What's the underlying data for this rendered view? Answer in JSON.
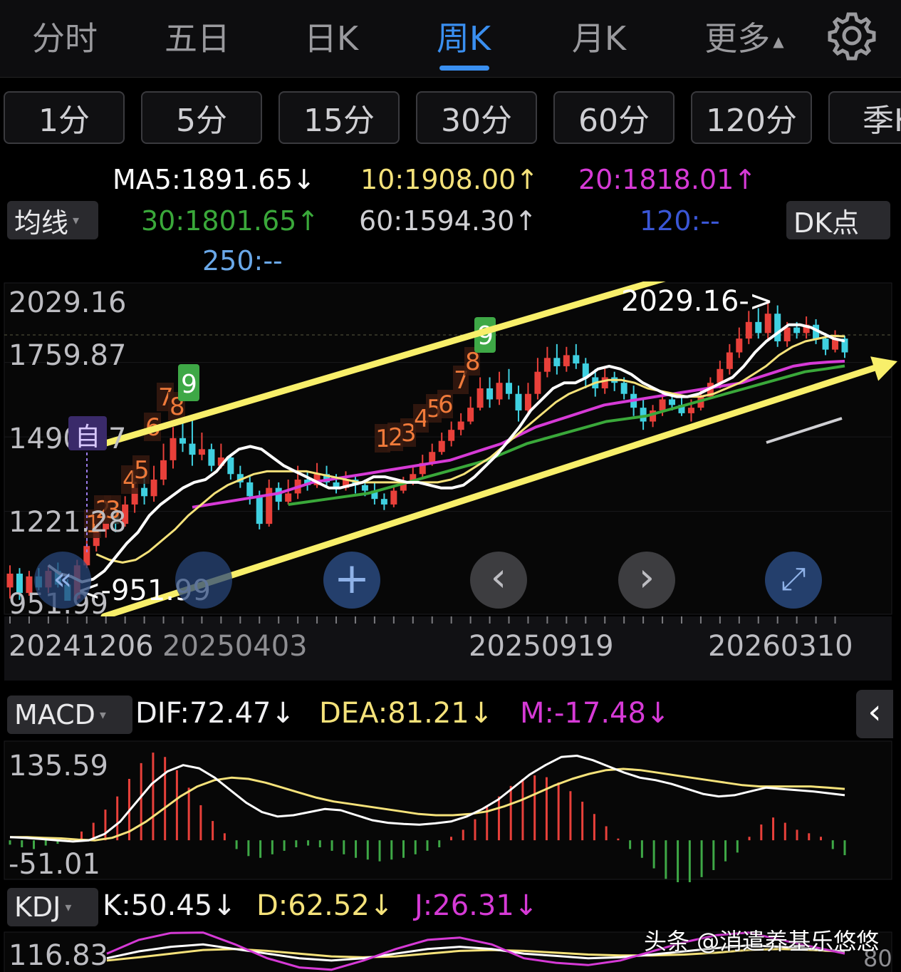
{
  "tabs": [
    {
      "label": "分时",
      "active": false
    },
    {
      "label": "五日",
      "active": false
    },
    {
      "label": "日K",
      "active": false
    },
    {
      "label": "周K",
      "active": true
    },
    {
      "label": "月K",
      "active": false
    },
    {
      "label": "更多",
      "active": false
    }
  ],
  "more_caret": "▲",
  "periods": [
    "1分",
    "5分",
    "15分",
    "30分",
    "60分",
    "120分",
    "季K"
  ],
  "ma_chip": "均线",
  "dk_chip": "DK点",
  "ma_labels": {
    "ma5": "MA5:1891.65↓",
    "ma10": "10:1908.00↑",
    "ma20": "20:1818.01↑",
    "ma30": "30:1801.65↑",
    "ma60": "60:1594.30↑",
    "ma120": "120:--",
    "ma250": "250:--"
  },
  "colors": {
    "up": "#e8403a",
    "down": "#3fd0e0",
    "ma5": "#ffffff",
    "ma10": "#f5e27a",
    "ma20": "#d63ad6",
    "ma30": "#3aa83a",
    "ma120": "#3a56d6",
    "ma250": "#6aa8e8",
    "active_tab": "#3a8ff0",
    "arrow": "#f8ef6a"
  },
  "chart_data": [
    {
      "type": "candlestick",
      "title": "周K",
      "price_labels": [
        "2029.16",
        "1759.87",
        "1490.57",
        "1221.28",
        "951.99"
      ],
      "ylim": [
        951.99,
        2029.16
      ],
      "date_labels": [
        "20241206",
        "20250403",
        "20250919",
        "20260310"
      ],
      "high_marker": "2029.16->",
      "low_marker": "<-951.99",
      "tag_自": "自",
      "sequence_tags": {
        "first": [
          "1",
          "2",
          "3",
          "4",
          "5",
          "6",
          "7",
          "8",
          "9"
        ],
        "second": [
          "1",
          "2",
          "3",
          "4",
          "5",
          "6",
          "7",
          "8",
          "9"
        ]
      },
      "candles": [
        [
          1000,
          1050,
          1080,
          960
        ],
        [
          1050,
          980,
          1070,
          955
        ],
        [
          980,
          1040,
          1060,
          970
        ],
        [
          1040,
          1000,
          1070,
          990
        ],
        [
          1000,
          1060,
          1080,
          980
        ],
        [
          1060,
          1010,
          1090,
          1000
        ],
        [
          1010,
          952,
          1030,
          952
        ],
        [
          960,
          1080,
          1100,
          955
        ],
        [
          1080,
          1150,
          1170,
          1070
        ],
        [
          1150,
          1210,
          1250,
          1130
        ],
        [
          1210,
          1260,
          1290,
          1180
        ],
        [
          1260,
          1230,
          1310,
          1200
        ],
        [
          1230,
          1300,
          1330,
          1220
        ],
        [
          1300,
          1360,
          1400,
          1270
        ],
        [
          1360,
          1330,
          1420,
          1300
        ],
        [
          1330,
          1390,
          1440,
          1310
        ],
        [
          1390,
          1460,
          1520,
          1370
        ],
        [
          1460,
          1540,
          1580,
          1430
        ],
        [
          1540,
          1520,
          1600,
          1490
        ],
        [
          1520,
          1480,
          1610,
          1440
        ],
        [
          1480,
          1500,
          1560,
          1460
        ],
        [
          1500,
          1440,
          1520,
          1420
        ],
        [
          1440,
          1470,
          1520,
          1430
        ],
        [
          1470,
          1410,
          1480,
          1390
        ],
        [
          1410,
          1380,
          1440,
          1360
        ],
        [
          1380,
          1330,
          1400,
          1300
        ],
        [
          1330,
          1230,
          1350,
          1210
        ],
        [
          1230,
          1360,
          1390,
          1220
        ],
        [
          1360,
          1310,
          1380,
          1280
        ],
        [
          1310,
          1340,
          1390,
          1300
        ],
        [
          1340,
          1390,
          1440,
          1320
        ],
        [
          1390,
          1370,
          1420,
          1350
        ],
        [
          1370,
          1410,
          1450,
          1360
        ],
        [
          1410,
          1380,
          1440,
          1360
        ],
        [
          1380,
          1360,
          1410,
          1340
        ],
        [
          1360,
          1390,
          1420,
          1350
        ],
        [
          1390,
          1370,
          1400,
          1340
        ],
        [
          1370,
          1350,
          1390,
          1330
        ],
        [
          1350,
          1320,
          1380,
          1300
        ],
        [
          1320,
          1300,
          1340,
          1280
        ],
        [
          1300,
          1350,
          1370,
          1290
        ],
        [
          1350,
          1380,
          1400,
          1340
        ],
        [
          1380,
          1410,
          1440,
          1370
        ],
        [
          1410,
          1450,
          1480,
          1400
        ],
        [
          1450,
          1490,
          1520,
          1440
        ],
        [
          1490,
          1530,
          1560,
          1480
        ],
        [
          1530,
          1570,
          1600,
          1510
        ],
        [
          1570,
          1600,
          1630,
          1550
        ],
        [
          1600,
          1650,
          1690,
          1590
        ],
        [
          1650,
          1720,
          1760,
          1640
        ],
        [
          1720,
          1680,
          1760,
          1650
        ],
        [
          1680,
          1740,
          1780,
          1660
        ],
        [
          1740,
          1700,
          1790,
          1680
        ],
        [
          1700,
          1640,
          1730,
          1600
        ],
        [
          1640,
          1700,
          1740,
          1620
        ],
        [
          1700,
          1780,
          1830,
          1680
        ],
        [
          1780,
          1830,
          1870,
          1760
        ],
        [
          1830,
          1800,
          1880,
          1770
        ],
        [
          1800,
          1840,
          1870,
          1780
        ],
        [
          1840,
          1810,
          1880,
          1790
        ],
        [
          1810,
          1760,
          1830,
          1720
        ],
        [
          1760,
          1720,
          1790,
          1690
        ],
        [
          1720,
          1760,
          1800,
          1700
        ],
        [
          1760,
          1740,
          1780,
          1710
        ],
        [
          1740,
          1700,
          1760,
          1680
        ],
        [
          1700,
          1650,
          1730,
          1620
        ],
        [
          1650,
          1600,
          1680,
          1570
        ],
        [
          1600,
          1640,
          1660,
          1580
        ],
        [
          1640,
          1680,
          1700,
          1620
        ],
        [
          1680,
          1660,
          1700,
          1640
        ],
        [
          1660,
          1630,
          1690,
          1620
        ],
        [
          1630,
          1650,
          1680,
          1600
        ],
        [
          1650,
          1690,
          1720,
          1640
        ],
        [
          1690,
          1740,
          1760,
          1680
        ],
        [
          1740,
          1790,
          1820,
          1720
        ],
        [
          1790,
          1850,
          1880,
          1770
        ],
        [
          1850,
          1900,
          1940,
          1830
        ],
        [
          1900,
          1960,
          2000,
          1880
        ],
        [
          1960,
          1920,
          2010,
          1900
        ],
        [
          1920,
          1990,
          2029,
          1900
        ],
        [
          1990,
          1890,
          2020,
          1870
        ],
        [
          1890,
          1940,
          1960,
          1870
        ],
        [
          1940,
          1920,
          1960,
          1900
        ],
        [
          1920,
          1950,
          1980,
          1900
        ],
        [
          1950,
          1900,
          1970,
          1880
        ],
        [
          1900,
          1860,
          1920,
          1840
        ],
        [
          1860,
          1900,
          1930,
          1850
        ],
        [
          1900,
          1850,
          1910,
          1830
        ]
      ],
      "ma5_series": [
        1080,
        1050,
        1040,
        1020,
        1030,
        1060,
        1110,
        1160,
        1200,
        1260,
        1300,
        1330,
        1360,
        1380,
        1390,
        1420,
        1470,
        1500,
        1510,
        1500,
        1470,
        1440,
        1420,
        1400,
        1380,
        1360,
        1360,
        1370,
        1380,
        1400,
        1400,
        1390,
        1380,
        1380,
        1370,
        1360,
        1360,
        1370,
        1400,
        1440,
        1480,
        1530,
        1580,
        1640,
        1680,
        1720,
        1740,
        1740,
        1760,
        1790,
        1800,
        1790,
        1770,
        1740,
        1720,
        1700,
        1690,
        1690,
        1700,
        1720,
        1740,
        1760,
        1800,
        1850,
        1890,
        1920,
        1950,
        1950,
        1940,
        1920,
        1900,
        1891
      ],
      "ma10_series": [
        1120,
        1100,
        1090,
        1100,
        1130,
        1170,
        1210,
        1260,
        1300,
        1340,
        1370,
        1390,
        1410,
        1420,
        1420,
        1420,
        1420,
        1410,
        1400,
        1390,
        1380,
        1380,
        1380,
        1380,
        1380,
        1380,
        1380,
        1390,
        1410,
        1440,
        1470,
        1510,
        1550,
        1590,
        1630,
        1670,
        1700,
        1720,
        1740,
        1750,
        1750,
        1740,
        1720,
        1710,
        1700,
        1690,
        1690,
        1700,
        1720,
        1740,
        1770,
        1800,
        1840,
        1870,
        1890,
        1900,
        1910,
        1908
      ],
      "ma20_series": [
        1290,
        1300,
        1310,
        1320,
        1330,
        1340,
        1360,
        1380,
        1390,
        1400,
        1410,
        1420,
        1430,
        1440,
        1450,
        1460,
        1480,
        1500,
        1520,
        1550,
        1580,
        1600,
        1620,
        1640,
        1660,
        1670,
        1680,
        1690,
        1700,
        1710,
        1720,
        1730,
        1740,
        1760,
        1780,
        1800,
        1810,
        1815,
        1818
      ],
      "ma30_series": [
        1300,
        1310,
        1320,
        1330,
        1340,
        1360,
        1380,
        1400,
        1420,
        1440,
        1460,
        1490,
        1520,
        1540,
        1560,
        1580,
        1600,
        1610,
        1620,
        1640,
        1660,
        1680,
        1700,
        1720,
        1740,
        1760,
        1780,
        1790,
        1801
      ]
    },
    {
      "type": "bar",
      "title": "MACD",
      "chip": "MACD",
      "labels": {
        "dif": "DIF:72.47↓",
        "dea": "DEA:81.21↓",
        "m": "M:-17.48↓"
      },
      "ylim_labels": [
        "135.59",
        "-51.01"
      ],
      "ylim": [
        -51.01,
        135.59
      ],
      "m_values": [
        -5,
        -8,
        -10,
        -6,
        -4,
        2,
        10,
        20,
        35,
        50,
        70,
        88,
        100,
        95,
        80,
        60,
        40,
        22,
        8,
        -10,
        -18,
        -20,
        -16,
        -12,
        -8,
        -6,
        -8,
        -12,
        -16,
        -20,
        -22,
        -24,
        -22,
        -20,
        -16,
        -12,
        -8,
        4,
        12,
        24,
        38,
        50,
        62,
        70,
        74,
        72,
        66,
        56,
        44,
        30,
        16,
        2,
        -10,
        -20,
        -32,
        -44,
        -50,
        -48,
        -42,
        -34,
        -24,
        -14,
        4,
        18,
        26,
        20,
        12,
        8,
        4,
        -10,
        -17
      ],
      "dif_series": [
        5,
        4,
        2,
        0,
        -2,
        0,
        10,
        30,
        60,
        90,
        110,
        120,
        115,
        100,
        80,
        60,
        45,
        38,
        40,
        45,
        50,
        48,
        40,
        32,
        28,
        26,
        25,
        27,
        30,
        38,
        50,
        65,
        85,
        105,
        120,
        133,
        135,
        128,
        118,
        108,
        100,
        96,
        90,
        82,
        74,
        70,
        72,
        78,
        84,
        82,
        80,
        78,
        75,
        72
      ],
      "dea_series": [
        5,
        5,
        4,
        3,
        1,
        0,
        4,
        14,
        30,
        50,
        70,
        86,
        96,
        100,
        98,
        92,
        84,
        76,
        68,
        62,
        58,
        54,
        50,
        46,
        42,
        40,
        40,
        42,
        46,
        54,
        64,
        76,
        88,
        98,
        106,
        112,
        114,
        112,
        108,
        104,
        100,
        96,
        92,
        88,
        86,
        86,
        86,
        86,
        84,
        82
      ],
      "zero_line": 0
    },
    {
      "type": "line",
      "title": "KDJ",
      "chip": "KDJ",
      "labels": {
        "k": "K:50.45↓",
        "d": "D:62.52↓",
        "j": "J:26.31↓"
      },
      "ylim_labels": [
        "116.83",
        "80"
      ],
      "k_series": [
        60,
        75,
        85,
        90,
        80,
        70,
        60,
        55,
        60,
        70,
        80,
        85,
        80,
        70,
        65,
        60,
        62,
        68,
        75,
        82,
        88,
        85,
        80,
        75
      ],
      "d_series": [
        55,
        62,
        70,
        78,
        80,
        76,
        70,
        64,
        62,
        64,
        70,
        76,
        78,
        76,
        72,
        68,
        66,
        66,
        68,
        72,
        78,
        80,
        78,
        74
      ],
      "j_series": [
        70,
        100,
        115,
        116,
        90,
        60,
        40,
        35,
        55,
        80,
        100,
        105,
        90,
        60,
        50,
        45,
        55,
        75,
        95,
        110,
        116,
        100,
        85,
        70
      ]
    }
  ],
  "zoom_controls": {
    "back": "«",
    "plus": "+",
    "prev": "‹",
    "next": "›",
    "expand": "⤢"
  },
  "side_toggle": "‹",
  "watermark": "头条 @消遣养基乐悠悠"
}
